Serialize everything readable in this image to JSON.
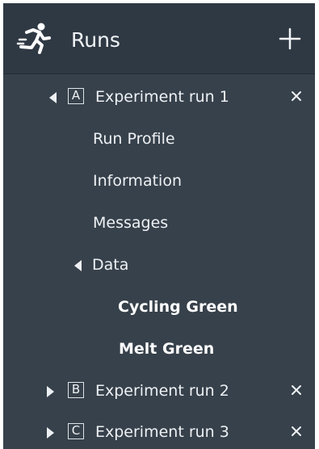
{
  "header": {
    "title": "Runs",
    "runner_icon": "running-person-icon",
    "add_icon": "plus-icon"
  },
  "runs": [
    {
      "letter": "A",
      "label": "Experiment run 1",
      "expanded": true
    },
    {
      "letter": "B",
      "label": "Experiment run 2",
      "expanded": false
    },
    {
      "letter": "C",
      "label": "Experiment run 3",
      "expanded": false
    }
  ],
  "run1_children": {
    "run_profile": "Run Profile",
    "information": "Information",
    "messages": "Messages",
    "data": {
      "label": "Data",
      "expanded": true,
      "items": [
        "Cycling Green",
        "Melt Green"
      ]
    }
  },
  "icons": {
    "expanded": "caret-left-icon",
    "collapsed": "caret-right-icon",
    "remove": "close-icon"
  },
  "colors": {
    "panel_background": "#37414b",
    "header_background": "#2f3944",
    "text": "#eef1f4"
  }
}
